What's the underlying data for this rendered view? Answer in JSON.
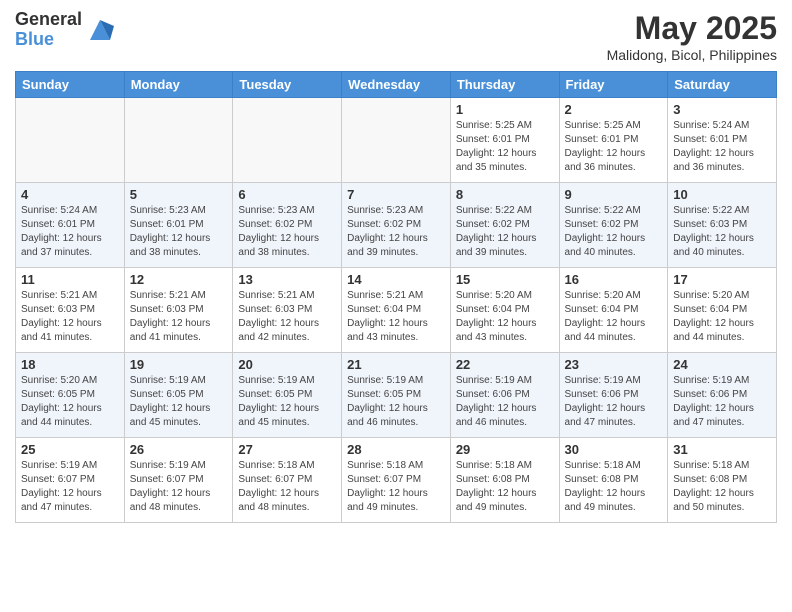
{
  "header": {
    "logo_general": "General",
    "logo_blue": "Blue",
    "month_title": "May 2025",
    "location": "Malidong, Bicol, Philippines"
  },
  "weekdays": [
    "Sunday",
    "Monday",
    "Tuesday",
    "Wednesday",
    "Thursday",
    "Friday",
    "Saturday"
  ],
  "weeks": [
    [
      {
        "day": "",
        "info": ""
      },
      {
        "day": "",
        "info": ""
      },
      {
        "day": "",
        "info": ""
      },
      {
        "day": "",
        "info": ""
      },
      {
        "day": "1",
        "info": "Sunrise: 5:25 AM\nSunset: 6:01 PM\nDaylight: 12 hours\nand 35 minutes."
      },
      {
        "day": "2",
        "info": "Sunrise: 5:25 AM\nSunset: 6:01 PM\nDaylight: 12 hours\nand 36 minutes."
      },
      {
        "day": "3",
        "info": "Sunrise: 5:24 AM\nSunset: 6:01 PM\nDaylight: 12 hours\nand 36 minutes."
      }
    ],
    [
      {
        "day": "4",
        "info": "Sunrise: 5:24 AM\nSunset: 6:01 PM\nDaylight: 12 hours\nand 37 minutes."
      },
      {
        "day": "5",
        "info": "Sunrise: 5:23 AM\nSunset: 6:01 PM\nDaylight: 12 hours\nand 38 minutes."
      },
      {
        "day": "6",
        "info": "Sunrise: 5:23 AM\nSunset: 6:02 PM\nDaylight: 12 hours\nand 38 minutes."
      },
      {
        "day": "7",
        "info": "Sunrise: 5:23 AM\nSunset: 6:02 PM\nDaylight: 12 hours\nand 39 minutes."
      },
      {
        "day": "8",
        "info": "Sunrise: 5:22 AM\nSunset: 6:02 PM\nDaylight: 12 hours\nand 39 minutes."
      },
      {
        "day": "9",
        "info": "Sunrise: 5:22 AM\nSunset: 6:02 PM\nDaylight: 12 hours\nand 40 minutes."
      },
      {
        "day": "10",
        "info": "Sunrise: 5:22 AM\nSunset: 6:03 PM\nDaylight: 12 hours\nand 40 minutes."
      }
    ],
    [
      {
        "day": "11",
        "info": "Sunrise: 5:21 AM\nSunset: 6:03 PM\nDaylight: 12 hours\nand 41 minutes."
      },
      {
        "day": "12",
        "info": "Sunrise: 5:21 AM\nSunset: 6:03 PM\nDaylight: 12 hours\nand 41 minutes."
      },
      {
        "day": "13",
        "info": "Sunrise: 5:21 AM\nSunset: 6:03 PM\nDaylight: 12 hours\nand 42 minutes."
      },
      {
        "day": "14",
        "info": "Sunrise: 5:21 AM\nSunset: 6:04 PM\nDaylight: 12 hours\nand 43 minutes."
      },
      {
        "day": "15",
        "info": "Sunrise: 5:20 AM\nSunset: 6:04 PM\nDaylight: 12 hours\nand 43 minutes."
      },
      {
        "day": "16",
        "info": "Sunrise: 5:20 AM\nSunset: 6:04 PM\nDaylight: 12 hours\nand 44 minutes."
      },
      {
        "day": "17",
        "info": "Sunrise: 5:20 AM\nSunset: 6:04 PM\nDaylight: 12 hours\nand 44 minutes."
      }
    ],
    [
      {
        "day": "18",
        "info": "Sunrise: 5:20 AM\nSunset: 6:05 PM\nDaylight: 12 hours\nand 44 minutes."
      },
      {
        "day": "19",
        "info": "Sunrise: 5:19 AM\nSunset: 6:05 PM\nDaylight: 12 hours\nand 45 minutes."
      },
      {
        "day": "20",
        "info": "Sunrise: 5:19 AM\nSunset: 6:05 PM\nDaylight: 12 hours\nand 45 minutes."
      },
      {
        "day": "21",
        "info": "Sunrise: 5:19 AM\nSunset: 6:05 PM\nDaylight: 12 hours\nand 46 minutes."
      },
      {
        "day": "22",
        "info": "Sunrise: 5:19 AM\nSunset: 6:06 PM\nDaylight: 12 hours\nand 46 minutes."
      },
      {
        "day": "23",
        "info": "Sunrise: 5:19 AM\nSunset: 6:06 PM\nDaylight: 12 hours\nand 47 minutes."
      },
      {
        "day": "24",
        "info": "Sunrise: 5:19 AM\nSunset: 6:06 PM\nDaylight: 12 hours\nand 47 minutes."
      }
    ],
    [
      {
        "day": "25",
        "info": "Sunrise: 5:19 AM\nSunset: 6:07 PM\nDaylight: 12 hours\nand 47 minutes."
      },
      {
        "day": "26",
        "info": "Sunrise: 5:19 AM\nSunset: 6:07 PM\nDaylight: 12 hours\nand 48 minutes."
      },
      {
        "day": "27",
        "info": "Sunrise: 5:18 AM\nSunset: 6:07 PM\nDaylight: 12 hours\nand 48 minutes."
      },
      {
        "day": "28",
        "info": "Sunrise: 5:18 AM\nSunset: 6:07 PM\nDaylight: 12 hours\nand 49 minutes."
      },
      {
        "day": "29",
        "info": "Sunrise: 5:18 AM\nSunset: 6:08 PM\nDaylight: 12 hours\nand 49 minutes."
      },
      {
        "day": "30",
        "info": "Sunrise: 5:18 AM\nSunset: 6:08 PM\nDaylight: 12 hours\nand 49 minutes."
      },
      {
        "day": "31",
        "info": "Sunrise: 5:18 AM\nSunset: 6:08 PM\nDaylight: 12 hours\nand 50 minutes."
      }
    ]
  ]
}
